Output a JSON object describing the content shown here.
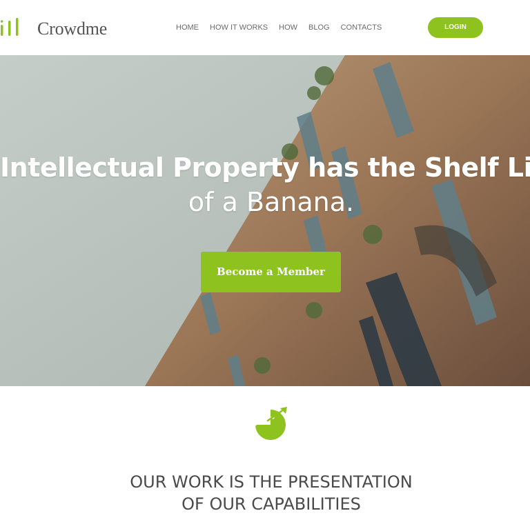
{
  "header": {
    "logo_icon": "bar-chart-logo-icon",
    "logo_text": "Crowdme",
    "nav": [
      "HOME",
      "HOW IT WORKS",
      "HOW",
      "BLOG",
      "CONTACTS"
    ],
    "login_label": "LOGIN"
  },
  "hero": {
    "title": "Intellectual Property has the Shelf Life",
    "subtitle": "of a Banana.",
    "cta_label": "Become a Member"
  },
  "section": {
    "icon": "growth-chart-icon",
    "heading_line1": "OUR WORK IS THE PRESENTATION",
    "heading_line2": "OF OUR CAPABILITIES"
  },
  "colors": {
    "accent": "#8dc21f",
    "nav_text": "#6b6b6b",
    "heading_text": "#4a4a4a"
  }
}
